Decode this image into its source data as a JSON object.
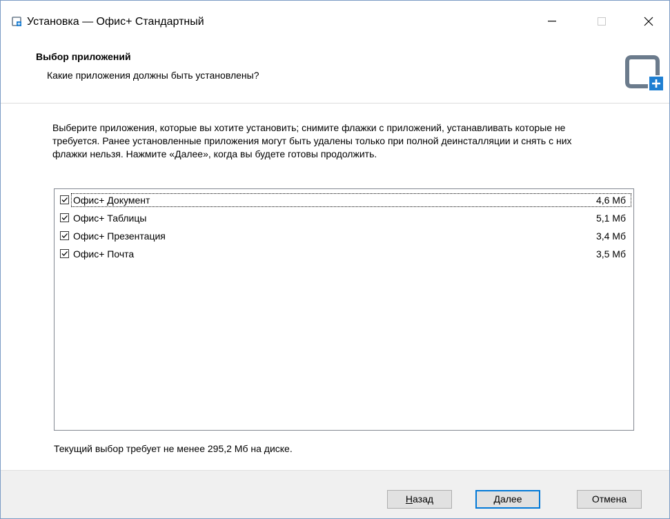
{
  "window": {
    "title": "Установка — Офис+ Стандартный",
    "controls": {
      "minimize": "—",
      "maximize": "☐",
      "close": "✕"
    }
  },
  "header": {
    "title": "Выбор приложений",
    "subtitle": "Какие приложения должны быть установлены?",
    "logo_icon": "app-logo-icon",
    "accent_color": "#1e7fd2",
    "logo_color": "#6b7b8c"
  },
  "description": "Выберите приложения, которые вы хотите установить; снимите флажки с приложений, устанавливать которые не требуется. Ранее установленные приложения могут быть удалены только при полной деинсталляции и снять с них флажки нельзя. Нажмите «Далее», когда вы будете готовы продолжить.",
  "components": [
    {
      "label": "Офис+ Документ",
      "size": "4,6 Мб",
      "checked": true
    },
    {
      "label": "Офис+ Таблицы",
      "size": "5,1 Мб",
      "checked": true
    },
    {
      "label": "Офис+ Презентация",
      "size": "3,4 Мб",
      "checked": true
    },
    {
      "label": "Офис+ Почта",
      "size": "3,5 Мб",
      "checked": true
    }
  ],
  "disk_info": "Текущий выбор требует не менее 295,2 Мб на диске.",
  "buttons": {
    "back": {
      "first": "Н",
      "rest": "азад"
    },
    "next": {
      "first": "Д",
      "rest": "алее"
    },
    "cancel": "Отмена"
  }
}
